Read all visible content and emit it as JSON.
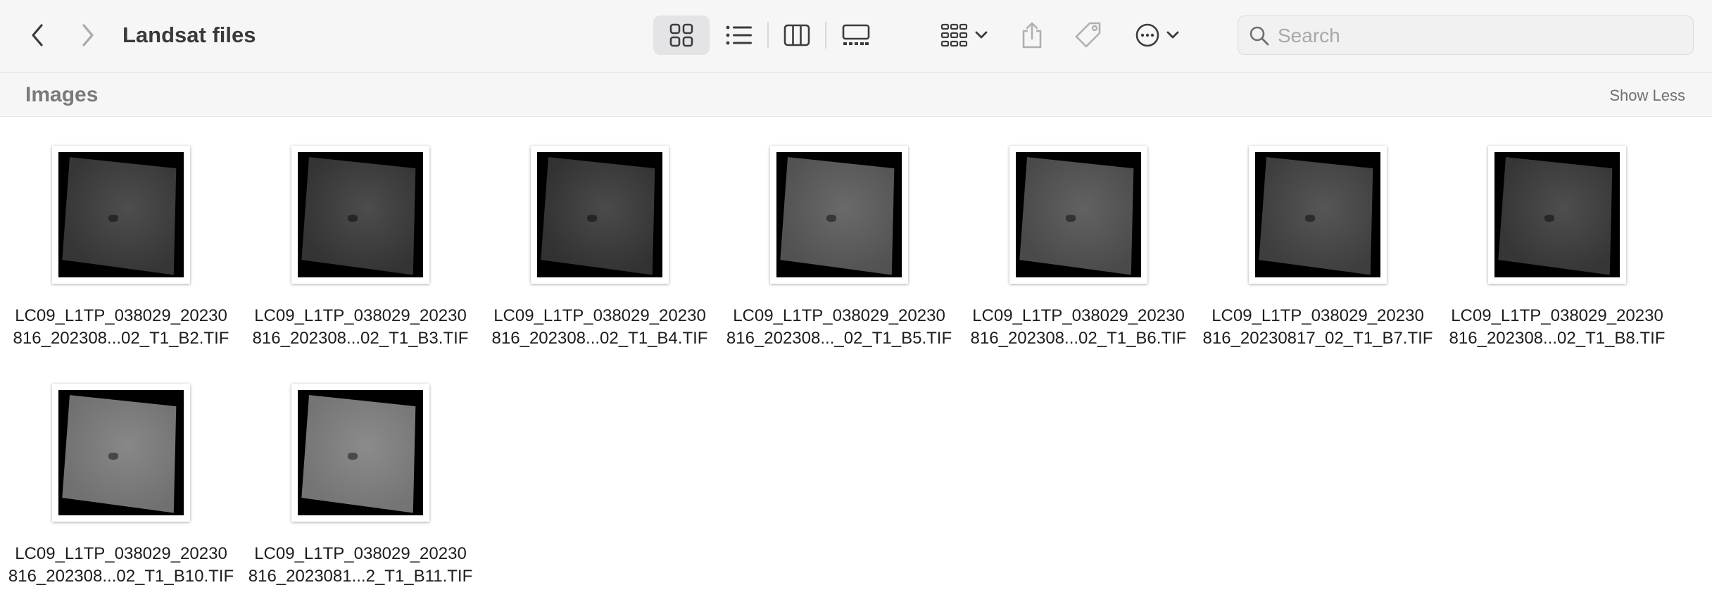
{
  "window": {
    "title": "Landsat files"
  },
  "toolbar": {
    "back_icon": "chevron-left-icon",
    "forward_icon": "chevron-right-icon",
    "view_modes": [
      "icons",
      "list",
      "columns",
      "gallery"
    ],
    "active_view": "icons",
    "search_placeholder": "Search",
    "search_value": ""
  },
  "section": {
    "title": "Images",
    "toggle_label": "Show Less"
  },
  "files": [
    {
      "line1": "LC09_L1TP_038029_20230",
      "line2": "816_202308...02_T1_B2.TIF",
      "tone": "#3a3a3a"
    },
    {
      "line1": "LC09_L1TP_038029_20230",
      "line2": "816_202308...02_T1_B3.TIF",
      "tone": "#383838"
    },
    {
      "line1": "LC09_L1TP_038029_20230",
      "line2": "816_202308...02_T1_B4.TIF",
      "tone": "#363636"
    },
    {
      "line1": "LC09_L1TP_038029_20230",
      "line2": "816_202308..._02_T1_B5.TIF",
      "tone": "#595959"
    },
    {
      "line1": "LC09_L1TP_038029_20230",
      "line2": "816_202308...02_T1_B6.TIF",
      "tone": "#505050"
    },
    {
      "line1": "LC09_L1TP_038029_20230",
      "line2": "816_20230817_02_T1_B7.TIF",
      "tone": "#434343"
    },
    {
      "line1": "LC09_L1TP_038029_20230",
      "line2": "816_202308...02_T1_B8.TIF",
      "tone": "#3a3a3a"
    },
    {
      "line1": "LC09_L1TP_038029_20230",
      "line2": "816_202308...02_T1_B10.TIF",
      "tone": "#7a7a7a"
    },
    {
      "line1": "LC09_L1TP_038029_20230",
      "line2": "816_2023081...2_T1_B11.TIF",
      "tone": "#7e7e7e"
    }
  ]
}
